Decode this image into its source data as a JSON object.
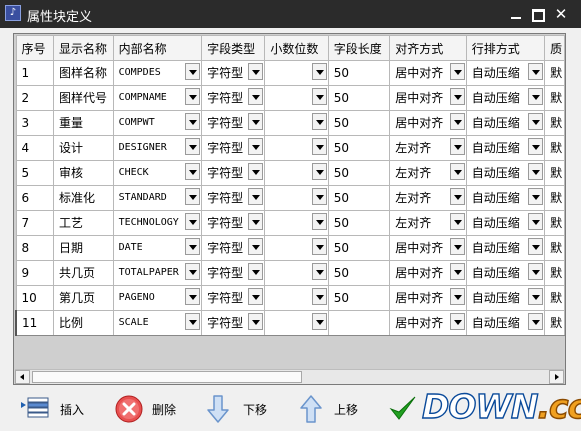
{
  "window": {
    "title": "属性块定义"
  },
  "grid": {
    "columns": [
      "序号",
      "显示名称",
      "内部名称",
      "字段类型",
      "小数位数",
      "字段长度",
      "对齐方式",
      "行排方式",
      "质"
    ],
    "rows": [
      {
        "no": "1",
        "display": "图样名称",
        "internal": "COMPDES",
        "type": "字符型",
        "decimals": "",
        "length": "50",
        "align": "居中对齐",
        "layout": "自动压缩",
        "extra": "默"
      },
      {
        "no": "2",
        "display": "图样代号",
        "internal": "COMPNAME",
        "type": "字符型",
        "decimals": "",
        "length": "50",
        "align": "居中对齐",
        "layout": "自动压缩",
        "extra": "默"
      },
      {
        "no": "3",
        "display": "重量",
        "internal": "COMPWT",
        "type": "字符型",
        "decimals": "",
        "length": "50",
        "align": "居中对齐",
        "layout": "自动压缩",
        "extra": "默"
      },
      {
        "no": "4",
        "display": "设计",
        "internal": "DESIGNER",
        "type": "字符型",
        "decimals": "",
        "length": "50",
        "align": "左对齐",
        "layout": "自动压缩",
        "extra": "默"
      },
      {
        "no": "5",
        "display": "审核",
        "internal": "CHECK",
        "type": "字符型",
        "decimals": "",
        "length": "50",
        "align": "左对齐",
        "layout": "自动压缩",
        "extra": "默"
      },
      {
        "no": "6",
        "display": "标准化",
        "internal": "STANDARD",
        "type": "字符型",
        "decimals": "",
        "length": "50",
        "align": "左对齐",
        "layout": "自动压缩",
        "extra": "默"
      },
      {
        "no": "7",
        "display": "工艺",
        "internal": "TECHNOLOGY",
        "type": "字符型",
        "decimals": "",
        "length": "50",
        "align": "左对齐",
        "layout": "自动压缩",
        "extra": "默"
      },
      {
        "no": "8",
        "display": "日期",
        "internal": "DATE",
        "type": "字符型",
        "decimals": "",
        "length": "50",
        "align": "居中对齐",
        "layout": "自动压缩",
        "extra": "默"
      },
      {
        "no": "9",
        "display": "共几页",
        "internal": "TOTALPAPER",
        "type": "字符型",
        "decimals": "",
        "length": "50",
        "align": "居中对齐",
        "layout": "自动压缩",
        "extra": "默"
      },
      {
        "no": "10",
        "display": "第几页",
        "internal": "PAGENO",
        "type": "字符型",
        "decimals": "",
        "length": "50",
        "align": "居中对齐",
        "layout": "自动压缩",
        "extra": "默"
      },
      {
        "no": "11",
        "display": "比例",
        "internal": "SCALE",
        "type": "字符型",
        "decimals": "",
        "length": "50",
        "align": "居中对齐",
        "layout": "自动压缩",
        "extra": "默"
      }
    ]
  },
  "toolbar": {
    "insert_label": "插入",
    "delete_label": "删除",
    "down_label": "下移",
    "up_label": "上移"
  },
  "watermark": {
    "main": "DOWN",
    "suffix": ".cc"
  },
  "colors": {
    "titlebar": "#2b2b2b",
    "selection": "#3399ff",
    "ok_check": "#1a9a1a",
    "delete_icon": "#e04040",
    "arrow_icon": "#8ab4e8"
  },
  "icons": [
    "app-icon",
    "minimize-icon",
    "maximize-icon",
    "close-icon",
    "dropdown-arrow-icon",
    "insert-icon",
    "delete-icon",
    "move-down-icon",
    "move-up-icon",
    "ok-check-icon"
  ]
}
